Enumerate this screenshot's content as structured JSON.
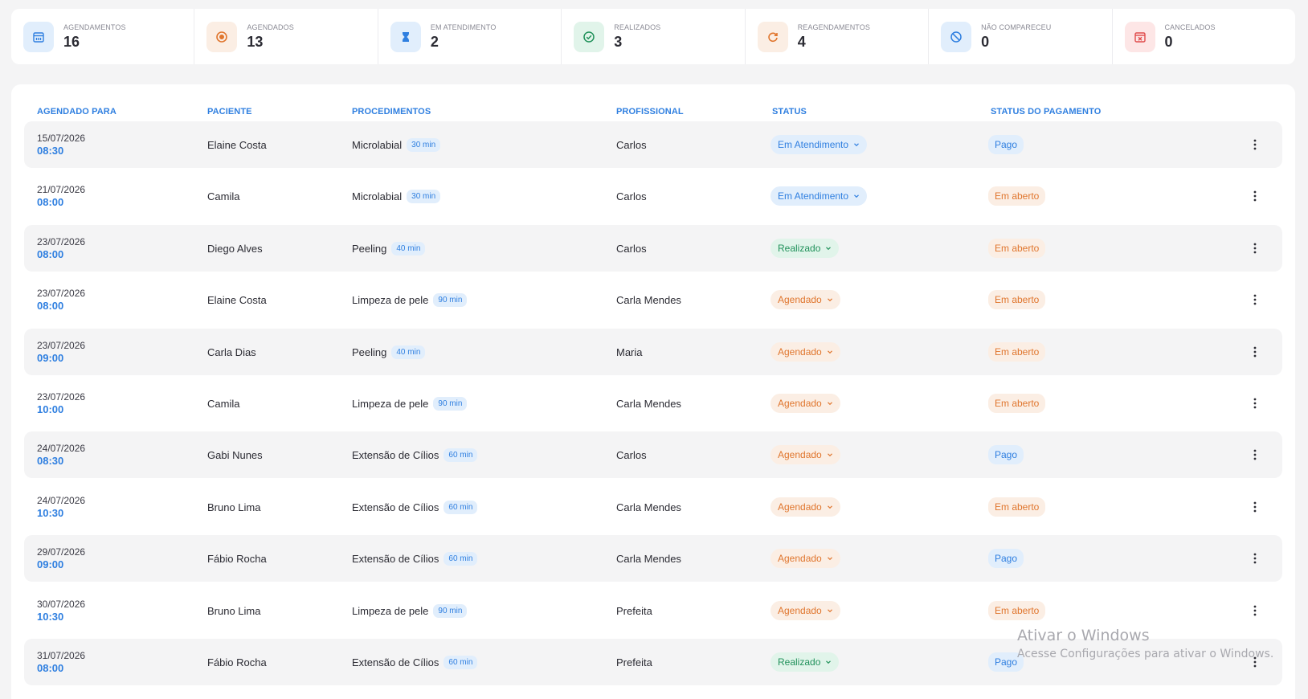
{
  "stats": [
    {
      "label": "Agendamentos",
      "value": "16",
      "icon": "calendar-icon",
      "bg": "#e1eefc",
      "fg": "#2f7fe0"
    },
    {
      "label": "Agendados",
      "value": "13",
      "icon": "clock-icon",
      "bg": "#fbeee4",
      "fg": "#e0762e"
    },
    {
      "label": "Em atendimento",
      "value": "2",
      "icon": "hourglass-icon",
      "bg": "#e1eefc",
      "fg": "#2f7fe0"
    },
    {
      "label": "Realizados",
      "value": "3",
      "icon": "check-circle-icon",
      "bg": "#e1f4ea",
      "fg": "#20915a"
    },
    {
      "label": "Reagendamentos",
      "value": "4",
      "icon": "refresh-icon",
      "bg": "#fbeee4",
      "fg": "#e0762e"
    },
    {
      "label": "Não compareceu",
      "value": "0",
      "icon": "ban-icon",
      "bg": "#e1eefc",
      "fg": "#2f7fe0"
    },
    {
      "label": "Cancelados",
      "value": "0",
      "icon": "calendar-x-icon",
      "bg": "#fde6e6",
      "fg": "#e04b4b"
    }
  ],
  "table": {
    "headers": {
      "agendado_para": "Agendado para",
      "paciente": "Paciente",
      "procedimentos": "Procedimentos",
      "profissional": "Profissional",
      "status": "Status",
      "status_pagamento": "Status do pagamento"
    },
    "rows": [
      {
        "date": "15/07/2026",
        "time": "08:30",
        "patient": "Elaine Costa",
        "procedure": "Microlabial",
        "duration": "30 min",
        "professional": "Carlos",
        "status": "Em Atendimento",
        "status_kind": "atend",
        "payment": "Pago",
        "payment_kind": "pago"
      },
      {
        "date": "21/07/2026",
        "time": "08:00",
        "patient": "Camila",
        "procedure": "Microlabial",
        "duration": "30 min",
        "professional": "Carlos",
        "status": "Em Atendimento",
        "status_kind": "atend",
        "payment": "Em aberto",
        "payment_kind": "aberto"
      },
      {
        "date": "23/07/2026",
        "time": "08:00",
        "patient": "Diego Alves",
        "procedure": "Peeling",
        "duration": "40 min",
        "professional": "Carlos",
        "status": "Realizado",
        "status_kind": "real",
        "payment": "Em aberto",
        "payment_kind": "aberto"
      },
      {
        "date": "23/07/2026",
        "time": "08:00",
        "patient": "Elaine Costa",
        "procedure": "Limpeza de pele",
        "duration": "90 min",
        "professional": "Carla Mendes",
        "status": "Agendado",
        "status_kind": "agen",
        "payment": "Em aberto",
        "payment_kind": "aberto"
      },
      {
        "date": "23/07/2026",
        "time": "09:00",
        "patient": "Carla Dias",
        "procedure": "Peeling",
        "duration": "40 min",
        "professional": "Maria",
        "status": "Agendado",
        "status_kind": "agen",
        "payment": "Em aberto",
        "payment_kind": "aberto"
      },
      {
        "date": "23/07/2026",
        "time": "10:00",
        "patient": "Camila",
        "procedure": "Limpeza de pele",
        "duration": "90 min",
        "professional": "Carla Mendes",
        "status": "Agendado",
        "status_kind": "agen",
        "payment": "Em aberto",
        "payment_kind": "aberto"
      },
      {
        "date": "24/07/2026",
        "time": "08:30",
        "patient": "Gabi Nunes",
        "procedure": "Extensão de Cílios",
        "duration": "60 min",
        "professional": "Carlos",
        "status": "Agendado",
        "status_kind": "agen",
        "payment": "Pago",
        "payment_kind": "pago"
      },
      {
        "date": "24/07/2026",
        "time": "10:30",
        "patient": "Bruno Lima",
        "procedure": "Extensão de Cílios",
        "duration": "60 min",
        "professional": "Carla Mendes",
        "status": "Agendado",
        "status_kind": "agen",
        "payment": "Em aberto",
        "payment_kind": "aberto"
      },
      {
        "date": "29/07/2026",
        "time": "09:00",
        "patient": "Fábio Rocha",
        "procedure": "Extensão de Cílios",
        "duration": "60 min",
        "professional": "Carla Mendes",
        "status": "Agendado",
        "status_kind": "agen",
        "payment": "Pago",
        "payment_kind": "pago"
      },
      {
        "date": "30/07/2026",
        "time": "10:30",
        "patient": "Bruno Lima",
        "procedure": "Limpeza de pele",
        "duration": "90 min",
        "professional": "Prefeita",
        "status": "Agendado",
        "status_kind": "agen",
        "payment": "Em aberto",
        "payment_kind": "aberto"
      },
      {
        "date": "31/07/2026",
        "time": "08:00",
        "patient": "Fábio Rocha",
        "procedure": "Extensão de Cílios",
        "duration": "60 min",
        "professional": "Prefeita",
        "status": "Realizado",
        "status_kind": "real",
        "payment": "Pago",
        "payment_kind": "pago"
      }
    ]
  },
  "watermark": {
    "title": "Ativar o Windows",
    "subtitle": "Acesse Configurações para ativar o Windows."
  }
}
